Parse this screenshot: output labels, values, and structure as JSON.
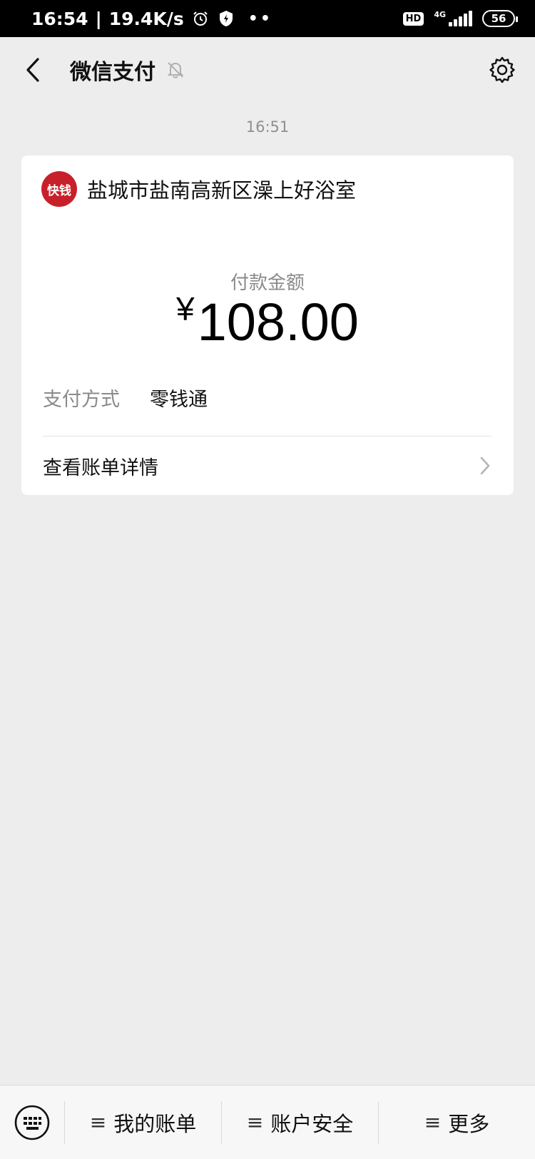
{
  "status_bar": {
    "time": "16:54",
    "speed": "19.4K/s",
    "hd": "HD",
    "network": "4G",
    "battery": "56"
  },
  "header": {
    "title": "微信支付"
  },
  "message": {
    "time": "16:51",
    "merchant": "盐城市盐南高新区澡上好浴室",
    "logo_text": "快钱",
    "amount_label": "付款金额",
    "currency": "¥",
    "amount": "108.00",
    "pay_method_label": "支付方式",
    "pay_method_value": "零钱通",
    "detail_label": "查看账单详情"
  },
  "bottom_menu": {
    "items": [
      {
        "icon": "≡",
        "label": "我的账单"
      },
      {
        "icon": "≡",
        "label": "账户安全"
      },
      {
        "icon": "≡",
        "label": "更多"
      }
    ]
  },
  "colors": {
    "background": "#ededed",
    "card": "#ffffff",
    "logo_red": "#c8202a",
    "muted_text": "#8a8a8a"
  }
}
